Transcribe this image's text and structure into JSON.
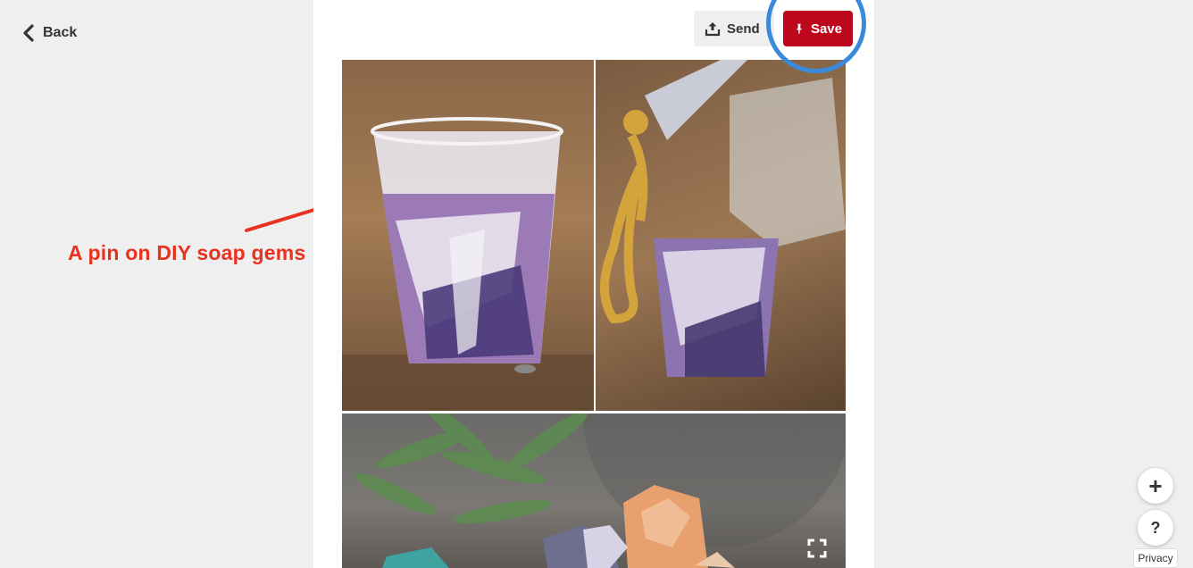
{
  "nav": {
    "back_label": "Back",
    "back_icon": "chevron-left-icon"
  },
  "pin_actions": {
    "send_label": "Send",
    "send_icon": "share-icon",
    "save_label": "Save",
    "save_icon": "pushpin-icon"
  },
  "annotation": {
    "text": "A pin on DIY soap gems",
    "color": "#e8321f",
    "highlight_color": "#3b8ad9"
  },
  "pin": {
    "expand_icon": "expand-icon"
  },
  "floating": {
    "plus_label": "+",
    "help_label": "?",
    "privacy_label": "Privacy"
  },
  "colors": {
    "save_red": "#bd081c",
    "page_bg": "#efefef"
  }
}
